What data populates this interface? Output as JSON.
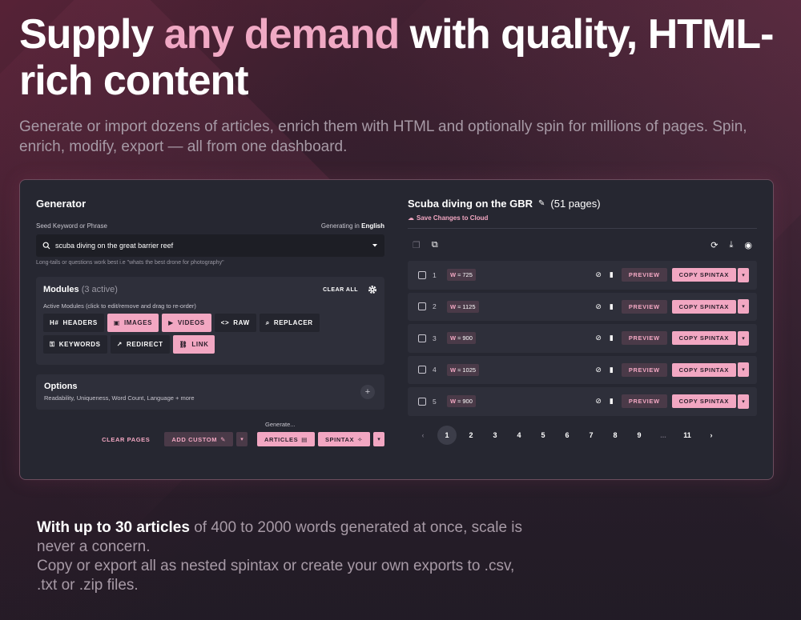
{
  "hero": {
    "title_pre": "Supply ",
    "title_accent": "any demand",
    "title_post": " with quality, HTML-rich content",
    "subtitle": "Generate or import dozens of articles, enrich them with HTML and optionally spin for millions of pages. Spin, enrich, modify, export — all from one dashboard."
  },
  "generator": {
    "title": "Generator",
    "seed_label": "Seed Keyword or Phrase",
    "generating_in": "Generating in",
    "language": "English",
    "seed_value": "scuba diving on the great barrier reef",
    "hint": "Long-tails or questions work best i.e \"whats the best drone for photography\"",
    "modules": {
      "title": "Modules",
      "active_count": "(3 active)",
      "clear_all": "CLEAR ALL",
      "subtitle": "Active Modules (click to edit/remove and drag to re-order)",
      "chips": [
        {
          "label": "HEADERS",
          "icon": "H#",
          "active": false
        },
        {
          "label": "IMAGES",
          "icon": "▣",
          "active": true
        },
        {
          "label": "VIDEOS",
          "icon": "▶",
          "active": true
        },
        {
          "label": "RAW",
          "icon": "<>",
          "active": false
        },
        {
          "label": "REPLACER",
          "icon": "⌕",
          "active": false
        },
        {
          "label": "KEYWORDS",
          "icon": "⚿",
          "active": false
        },
        {
          "label": "REDIRECT",
          "icon": "↗",
          "active": false
        },
        {
          "label": "LINK",
          "icon": "⛓",
          "active": true
        }
      ]
    },
    "options": {
      "title": "Options",
      "subtitle": "Readability, Uniqueness, Word Count, Language + more",
      "plus": "+"
    },
    "generate_label": "Generate...",
    "clear_pages": "CLEAR PAGES",
    "add_custom": "ADD CUSTOM",
    "articles": "ARTICLES",
    "spintax": "SPINTAX"
  },
  "project": {
    "title": "Scuba diving on the GBR",
    "pages_count": "(51 pages)",
    "save": "Save Changes to Cloud",
    "preview_label": "PREVIEW",
    "copy_label": "COPY SPINTAX",
    "rows": [
      {
        "num": "1",
        "words": "725"
      },
      {
        "num": "2",
        "words": "1125"
      },
      {
        "num": "3",
        "words": "900"
      },
      {
        "num": "4",
        "words": "1025"
      },
      {
        "num": "5",
        "words": "900"
      }
    ],
    "pagination": [
      "1",
      "2",
      "3",
      "4",
      "5",
      "6",
      "7",
      "8",
      "9",
      "...",
      "11"
    ]
  },
  "outro": {
    "highlight": "With up to 30 articles",
    "rest": " of 400 to 2000 words generated at once, scale is never a concern.",
    "line2": "Copy or export all as nested spintax or create your own exports to .csv, .txt or .zip files."
  },
  "colors": {
    "accent": "#f2a7c2",
    "panel": "#262731",
    "card": "#2e2f3a"
  }
}
